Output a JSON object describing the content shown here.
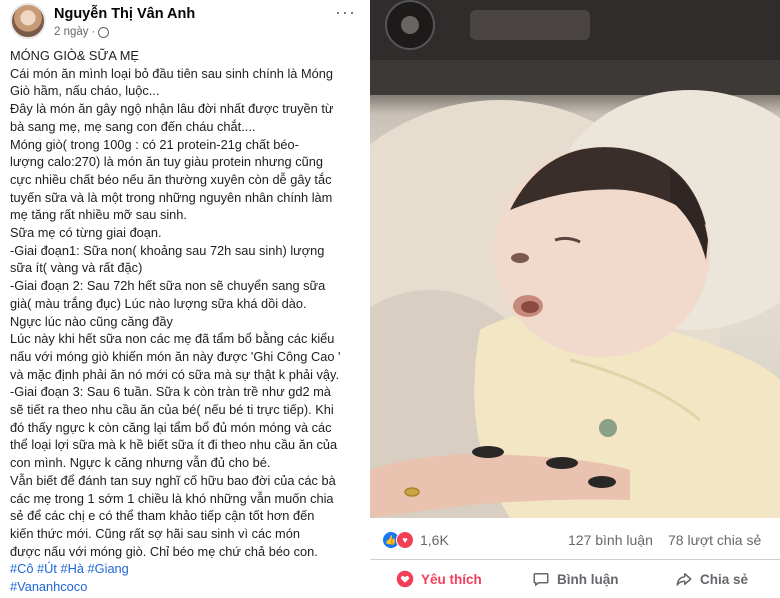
{
  "post": {
    "author": "Nguyễn Thị Vân Anh",
    "time": "2 ngày",
    "more": "···",
    "lines": [
      "MÓNG GIÒ& SỮA MẸ",
      "Cái món ăn mình loại bỏ đầu tiên sau sinh chính là Móng",
      "Giò hầm, nấu cháo, luộc...",
      "Đây là món ăn gây ngộ nhận lâu đời nhất được truyền từ",
      "bà sang mẹ, mẹ sang con đến cháu chắt....",
      "Móng giò( trong 100g : có 21 protein-21g chất béo-",
      "lượng calo:270) là món ăn tuy giàu protein nhưng cũng",
      "cực nhiều chất béo nếu ăn thường xuyên còn dễ gây tắc",
      "tuyến sữa và là một trong những nguyên nhân chính làm",
      "mẹ tăng rất nhiều mỡ sau sinh.",
      "Sữa mẹ có từng giai đoạn.",
      "-Giai đoạn1: Sữa non( khoảng sau 72h sau sinh) lượng",
      "sữa ít( vàng và rất đặc)",
      "-Giai đoạn 2: Sau 72h hết sữa non sẽ chuyển sang sữa",
      "già( màu trắng đục) Lúc nào lượng sữa khá dồi dào.",
      "Ngực lúc nào cũng căng đầy",
      "Lúc này khi hết sữa non các mẹ đã tẩm bổ bằng các kiểu",
      "nấu với móng giò khiến món ăn này được 'Ghi Công Cao '",
      "và mặc định phải ăn nó mới có sữa mà sự thật k phải vậy.",
      "-Giai đoạn 3: Sau 6 tuần. Sữa k còn tràn trề như gd2 mà",
      "sẽ tiết ra theo nhu cầu ăn của bé( nếu bé ti trực tiếp). Khi",
      "đó thấy ngực k còn căng lại tẩm bổ đủ món móng và các",
      "thể loại lợi sữa mà k hề biết sữa ít đi theo nhu cầu ăn của",
      "con mình. Ngực k căng nhưng vẫn đủ cho bé.",
      "Vẫn biết để đánh tan suy nghĩ cố hữu bao đời của các bà",
      "các mẹ trong 1 sớm 1 chiều là khó những vẫn muốn chia",
      "sẻ để các chị e có thể tham khảo tiếp cận tốt hơn đến",
      "kiến thức mới. Cũng rất sợ hãi sau sinh vì các món",
      "được nấu với móng giò. Chỉ béo mẹ chứ chả béo con."
    ],
    "hashtags": "#Cô #Út #Hà #Giang",
    "hashtag2": "#Vananhcoco"
  },
  "stats": {
    "reactions": "1,6K",
    "comments": "127 bình luận",
    "shares": "78 lượt chia sẻ"
  },
  "actions": {
    "like": "Yêu thích",
    "comment": "Bình luận",
    "share": "Chia sẻ"
  },
  "colors": {
    "like_blue": "#1877f2",
    "love_red": "#f33e58",
    "hashtag": "#2067d6",
    "muted": "#65676b"
  },
  "icons": [
    "globe-icon",
    "more-icon",
    "like-reaction-icon",
    "love-reaction-icon",
    "heart-icon",
    "comment-icon",
    "share-icon"
  ]
}
